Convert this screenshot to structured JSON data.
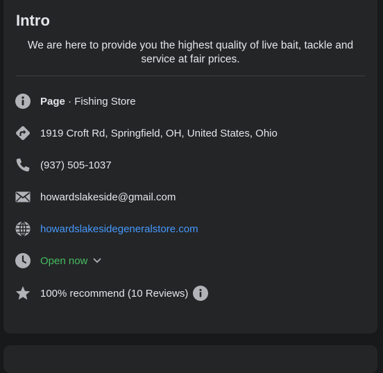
{
  "intro": {
    "title": "Intro",
    "bio": "We are here to provide you the highest quality of live bait, tackle and service at fair prices."
  },
  "details": {
    "page_label": "Page",
    "page_separator": " · ",
    "category": "Fishing Store",
    "address": "1919 Croft Rd, Springfield, OH, United States, Ohio",
    "phone": "(937) 505-1037",
    "email": "howardslakeside@gmail.com",
    "website": "howardslakesidegeneralstore.com",
    "hours_status": "Open now",
    "rating": "100% recommend (10 Reviews)"
  },
  "colors": {
    "background": "#18191a",
    "card": "#242526",
    "text": "#e4e6eb",
    "icon": "#b0b3b8",
    "link": "#4599ff",
    "open": "#45bd62"
  },
  "icons": [
    "info-icon",
    "directions-icon",
    "phone-icon",
    "mail-icon",
    "globe-icon",
    "clock-icon",
    "chevron-down-icon",
    "star-icon",
    "rating-info-icon"
  ]
}
